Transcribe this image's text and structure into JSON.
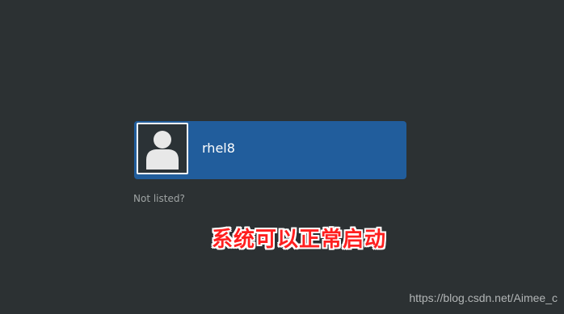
{
  "login": {
    "user": {
      "name": "rhel8",
      "avatar_icon": "user-silhouette-icon"
    },
    "not_listed_label": "Not listed?"
  },
  "annotation": {
    "text": "系统可以正常启动",
    "color": "#ff1f1f"
  },
  "watermark": {
    "text": "https://blog.csdn.net/Aimee_c"
  },
  "colors": {
    "background": "#2c3133",
    "user_row": "#215d9c"
  }
}
